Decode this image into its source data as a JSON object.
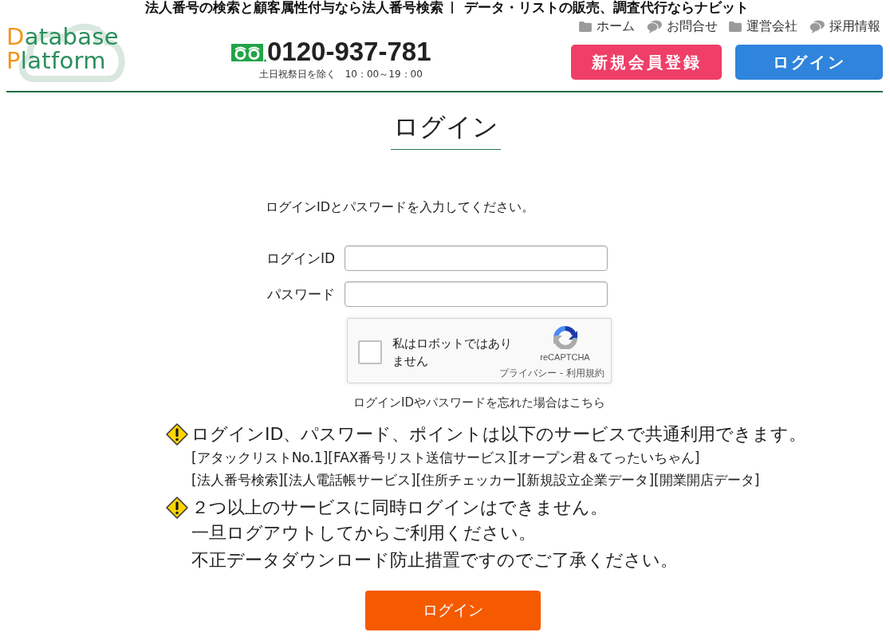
{
  "header": {
    "taglines": [
      "法人番号の検索と顧客属性付与なら法人番号検索",
      "データ・リストの販売、調査代行ならナビット"
    ],
    "logo": {
      "lines": [
        "Database",
        "Platform"
      ]
    },
    "phone": {
      "number": "0120-937-781",
      "hours": "土日祝祭日を除く　10：00～19：00"
    },
    "nav": [
      {
        "label": "ホーム",
        "kind": "folder"
      },
      {
        "label": "お問合せ",
        "kind": "chat"
      },
      {
        "label": "運営会社",
        "kind": "folder"
      },
      {
        "label": "採用情報",
        "kind": "chat"
      }
    ],
    "buttons": [
      {
        "label": "新規会員登録",
        "kind": "register"
      },
      {
        "label": "ログイン",
        "kind": "login"
      }
    ]
  },
  "page_title": "ログイン",
  "form": {
    "instruction": "ログインIDとパスワードを入力してください。",
    "fields": [
      {
        "label": "ログインID"
      },
      {
        "label": "パスワード"
      }
    ],
    "captcha": {
      "label": "私はロボットではありません",
      "checked": false,
      "brand": "reCAPTCHA",
      "links": [
        "プライバシー",
        "利用規約"
      ],
      "link_separator": "-"
    },
    "forgot_link": "ログインIDやパスワードを忘れた場合はこちら"
  },
  "notices": [
    {
      "heading": "ログインID、パスワード、ポイントは以下のサービスで共通利用できます。",
      "services": [
        "[アタックリストNo.1][FAX番号リスト送信サービス][オープン君＆てったいちゃん]",
        "[法人番号検索][法人電話帳サービス][住所チェッカー][新規設立企業データ][開業開店データ]"
      ]
    },
    {
      "heading": "２つ以上のサービスに同時ログインはできません。",
      "lines": [
        "一旦ログアウトしてからご利用ください。",
        "不正データダウンロード防止措置ですのでご了承ください。"
      ]
    }
  ],
  "submit_button": "ログイン"
}
